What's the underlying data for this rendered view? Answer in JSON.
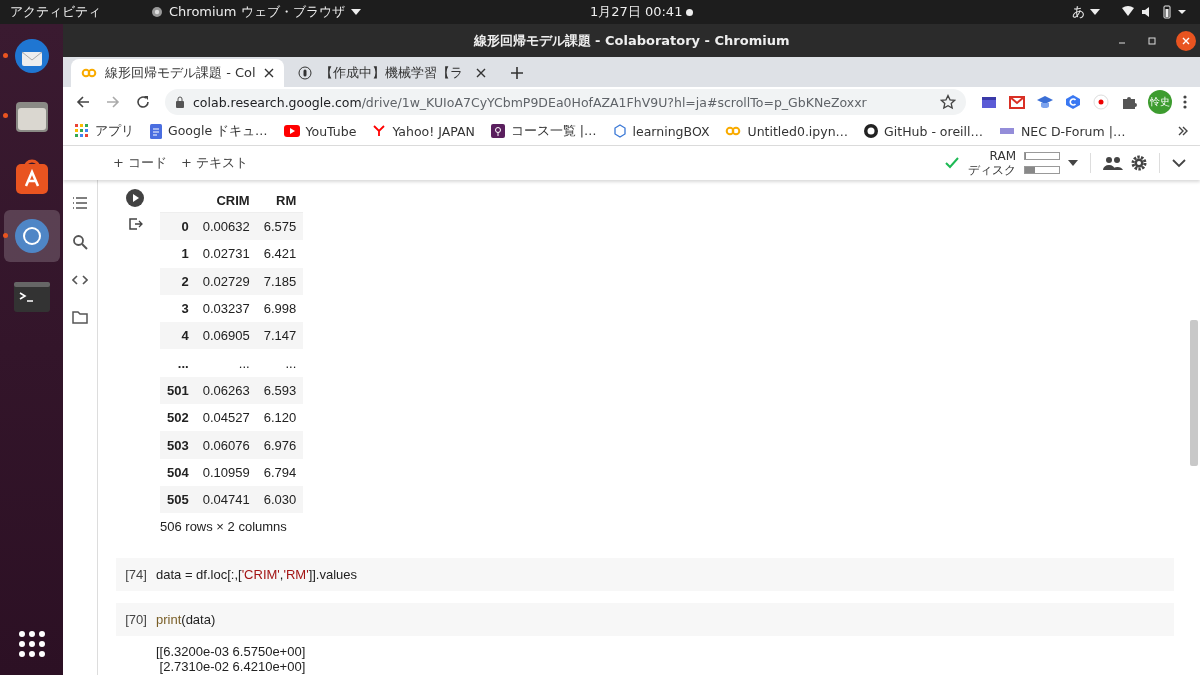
{
  "top_bar": {
    "activities": "アクティビティ",
    "app_menu": "Chromium ウェブ・ブラウザ",
    "clock": "1月27日  00:41",
    "input_method": "あ"
  },
  "dock": {
    "items": [
      {
        "kind": "mail",
        "running": true,
        "selected": false
      },
      {
        "kind": "files",
        "running": true,
        "selected": false
      },
      {
        "kind": "store",
        "running": false,
        "selected": false
      },
      {
        "kind": "browser",
        "running": true,
        "selected": true
      },
      {
        "kind": "terminal",
        "running": false,
        "selected": false
      }
    ]
  },
  "window": {
    "title": "線形回帰モデル課題 - Colaboratory - Chromium"
  },
  "tabs": [
    {
      "label": "線形回帰モデル課題 - Col",
      "kind": "colab",
      "selected": true
    },
    {
      "label": "【作成中】機械学習【ラ",
      "kind": "page",
      "selected": false
    }
  ],
  "address_bar": {
    "host": "colab.research.google.com",
    "path": "/drive/1w_KUIoA7CyYCbmP9DEa0HofAZA1FhV9U?hl=ja#scrollTo=p_GbKNeZoxxr"
  },
  "profile": {
    "initials": "怜史"
  },
  "bookmarks": [
    {
      "label": "アプリ",
      "kind": "apps"
    },
    {
      "label": "Google ドキュ…",
      "kind": "docs"
    },
    {
      "label": "YouTube",
      "kind": "youtube"
    },
    {
      "label": "Yahoo! JAPAN",
      "kind": "yahoo"
    },
    {
      "label": "コース一覧 |…",
      "kind": "course"
    },
    {
      "label": "learningBOX",
      "kind": "box"
    },
    {
      "label": "Untitled0.ipyn…",
      "kind": "colab"
    },
    {
      "label": "GitHub - oreill…",
      "kind": "github"
    },
    {
      "label": "NEC D-Forum |…",
      "kind": "nec"
    }
  ],
  "toolbar": {
    "add_code": "+ コード",
    "add_text": "+ テキスト",
    "ram_label": "RAM",
    "disk_label": "ディスク",
    "ram": {
      "level": 0.03
    },
    "disk": {
      "level": 0.3
    }
  },
  "table": {
    "columns": [
      "CRIM",
      "RM"
    ],
    "rows": [
      {
        "index": "0",
        "values": [
          "0.00632",
          "6.575"
        ]
      },
      {
        "index": "1",
        "values": [
          "0.02731",
          "6.421"
        ]
      },
      {
        "index": "2",
        "values": [
          "0.02729",
          "7.185"
        ]
      },
      {
        "index": "3",
        "values": [
          "0.03237",
          "6.998"
        ]
      },
      {
        "index": "4",
        "values": [
          "0.06905",
          "7.147"
        ]
      },
      {
        "index": "...",
        "values": [
          "...",
          "..."
        ]
      },
      {
        "index": "501",
        "values": [
          "0.06263",
          "6.593"
        ]
      },
      {
        "index": "502",
        "values": [
          "0.04527",
          "6.120"
        ]
      },
      {
        "index": "503",
        "values": [
          "0.06076",
          "6.976"
        ]
      },
      {
        "index": "504",
        "values": [
          "0.10959",
          "6.794"
        ]
      },
      {
        "index": "505",
        "values": [
          "0.04741",
          "6.030"
        ]
      }
    ],
    "summary": "506 rows × 2 columns"
  },
  "cells": [
    {
      "count": "[74]",
      "code": [
        {
          "text": "data = df.loc[:,[",
          "kind": "plain"
        },
        {
          "text": "'CRIM'",
          "kind": "string"
        },
        {
          "text": ",",
          "kind": "plain"
        },
        {
          "text": "'RM'",
          "kind": "string"
        },
        {
          "text": "]].values",
          "kind": "plain"
        }
      ]
    },
    {
      "count": "[70]",
      "code": [
        {
          "text": "print",
          "kind": "builtin"
        },
        {
          "text": "(data)",
          "kind": "plain"
        }
      ],
      "output": [
        "[[6.3200e-03 6.5750e+00]",
        " [2.7310e-02 6.4210e+00]"
      ]
    }
  ]
}
